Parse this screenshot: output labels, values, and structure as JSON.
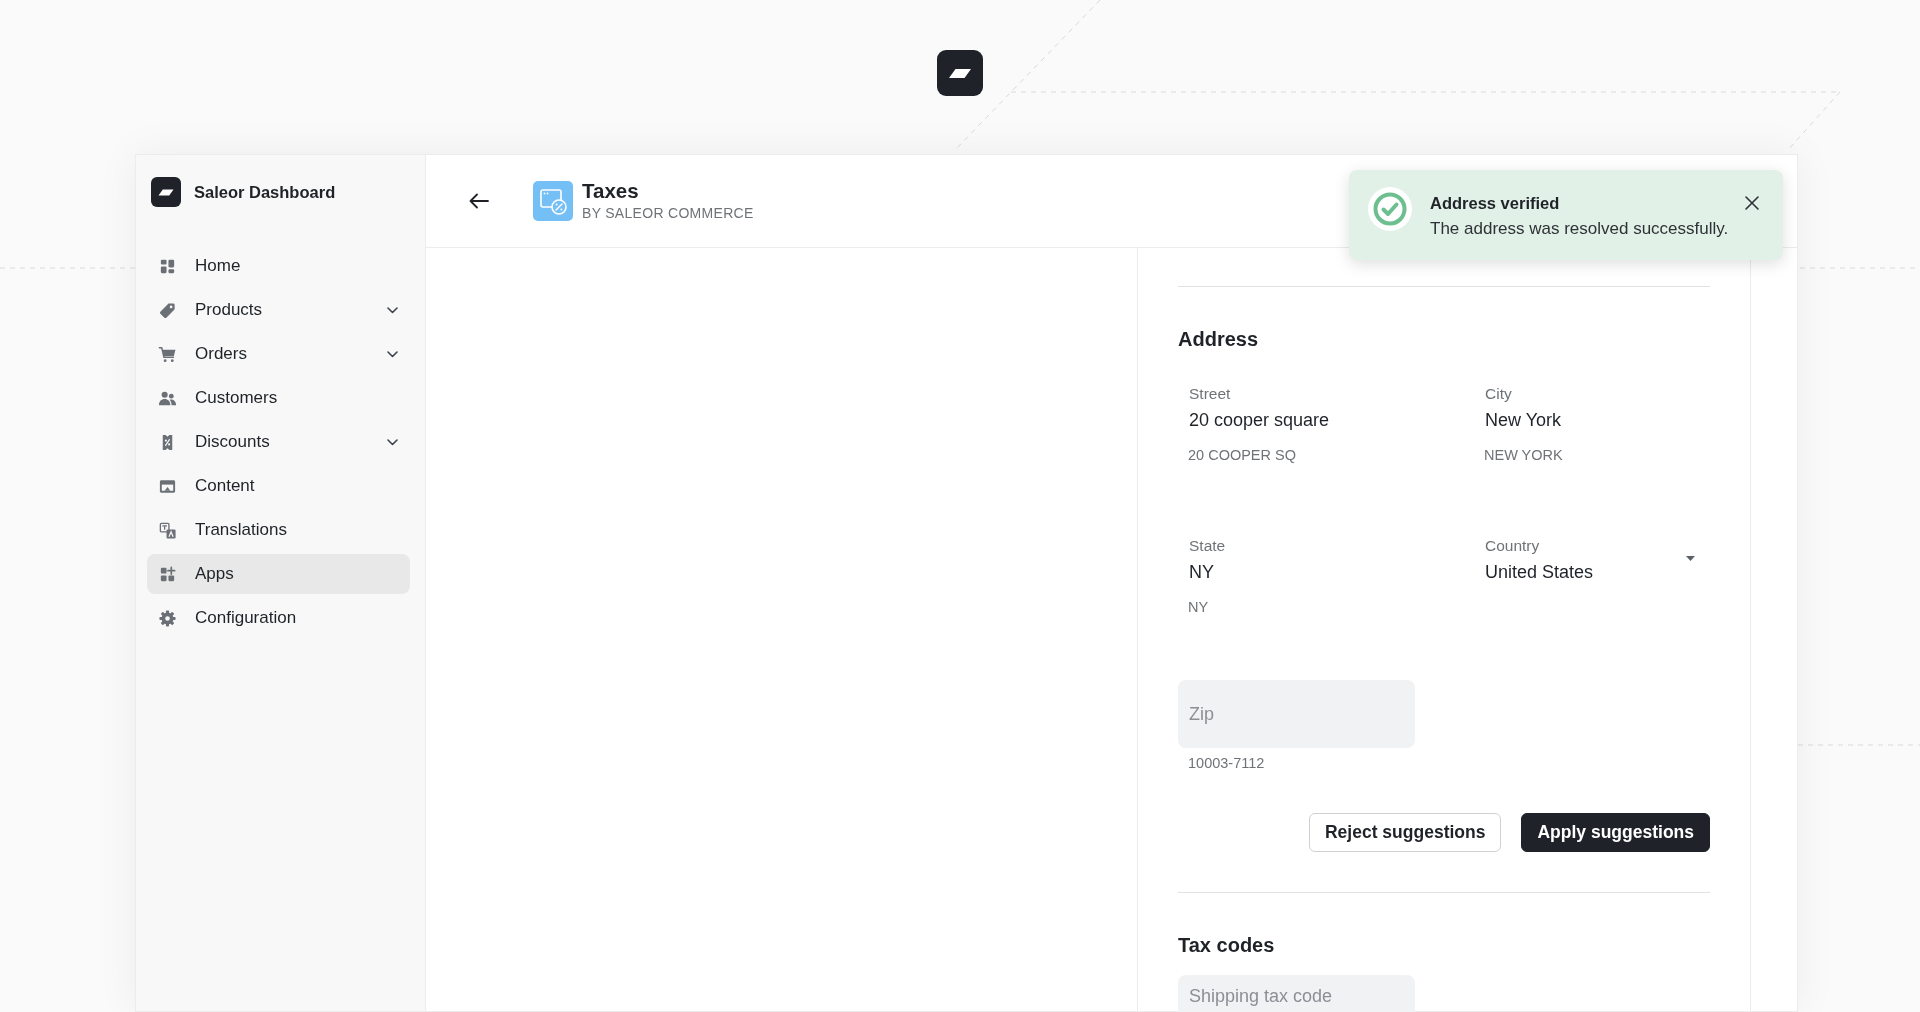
{
  "sidebar": {
    "title": "Saleor Dashboard",
    "items": [
      {
        "label": "Home",
        "expandable": false,
        "selected": false
      },
      {
        "label": "Products",
        "expandable": true,
        "selected": false
      },
      {
        "label": "Orders",
        "expandable": true,
        "selected": false
      },
      {
        "label": "Customers",
        "expandable": false,
        "selected": false
      },
      {
        "label": "Discounts",
        "expandable": true,
        "selected": false
      },
      {
        "label": "Content",
        "expandable": false,
        "selected": false
      },
      {
        "label": "Translations",
        "expandable": false,
        "selected": false
      },
      {
        "label": "Apps",
        "expandable": false,
        "selected": true
      },
      {
        "label": "Configuration",
        "expandable": false,
        "selected": false
      }
    ]
  },
  "header": {
    "title": "Taxes",
    "subtitle": "BY SALEOR COMMERCE"
  },
  "toast": {
    "title": "Address verified",
    "message": "The address was resolved successfully."
  },
  "address": {
    "heading": "Address",
    "fields": [
      {
        "kind": "text",
        "label": "Street",
        "value": "20 cooper square",
        "suggestion": "20 COOPER SQ"
      },
      {
        "kind": "text",
        "label": "City",
        "value": "New York",
        "suggestion": "NEW YORK"
      },
      {
        "kind": "text",
        "label": "State",
        "value": "NY",
        "suggestion": "NY"
      },
      {
        "kind": "select",
        "label": "Country",
        "value": "United States"
      },
      {
        "kind": "text",
        "placeholder": "Zip",
        "suggestion": "10003-7112"
      }
    ],
    "buttons": [
      {
        "kind": "secondary",
        "label": "Reject suggestions"
      },
      {
        "kind": "primary",
        "label": "Apply suggestions"
      }
    ]
  },
  "tax_codes": {
    "heading": "Tax codes",
    "fields": [
      {
        "kind": "text",
        "placeholder": "Shipping tax code"
      }
    ]
  }
}
